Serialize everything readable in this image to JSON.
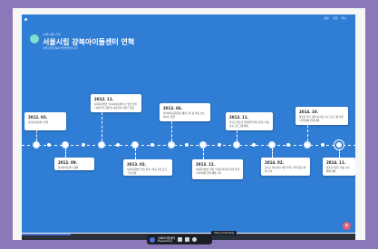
{
  "app": {
    "small_label": "[서울시청] 기관",
    "title": "서울시립 강북아이들센터 연혁",
    "subtitle": "서울시립강북아이들센터입니다",
    "top_menu": [
      "공유",
      "설정",
      "메뉴"
    ]
  },
  "timeline": {
    "above": [
      {
        "year": "2012. 03.",
        "text": "강북아이들센터 설립"
      },
      {
        "year": "2012. 11.",
        "text": "사회복지법인 '강북아이들센터'로 법인 설립 / 아동주거 개선 및 아동복지 서비스 제공"
      },
      {
        "year": "2013. 06.",
        "text": "지역사회 통합돌봄 체계 구축 및 아동 보호 서비스 운영"
      },
      {
        "year": "2013. 11.",
        "text": "강북구 청소년 지원사업 위탁 운영 / 아동 보호 프로그램 확대"
      },
      {
        "year": "2014. 10.",
        "text": "청소년 진로 지원 및 아동 보호 프로그램 운영 / 지역사회 연계 강화"
      }
    ],
    "below": [
      {
        "year": "2012. 09.",
        "text": "강북아이들센터 개원"
      },
      {
        "year": "2013. 02.",
        "text": "사회복지법인 설립 허가 / 아동 보호 프로그램 운영"
      },
      {
        "year": "2013. 12.",
        "text": "사회복지법인 지정 / 아동복지 전문기관 운영 / 지역사회 협력 체계 구축"
      },
      {
        "year": "2014. 02.",
        "text": "강북구 아동복지 사업 수행 / 지역 돌봄 체계 구축"
      },
      {
        "year": "2014. 11.",
        "text": "청소년 지원 / 아동 보호 체계 강화"
      }
    ]
  },
  "dock": {
    "presenter": "강북아이들센터",
    "status": "Presenting"
  },
  "tooltip": "Stop presenting"
}
